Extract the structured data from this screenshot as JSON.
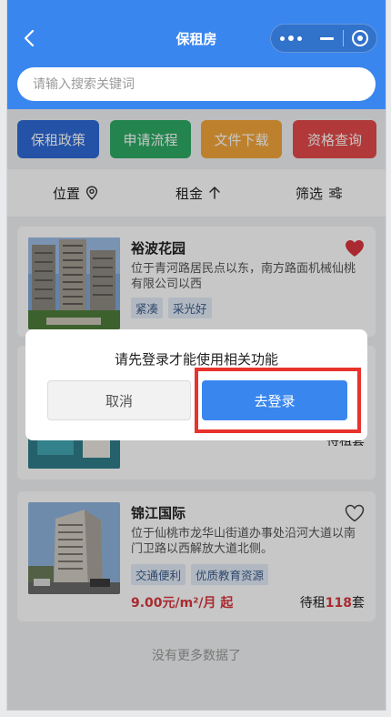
{
  "header": {
    "title": "保租房",
    "back_icon": "chevron-left-icon",
    "more_icon": "more-dots-icon",
    "minimize_icon": "minimize-icon",
    "close_icon": "target-close-icon"
  },
  "search": {
    "placeholder": "请输入搜索关键词",
    "value": ""
  },
  "quick_links": [
    {
      "label": "保租政策",
      "color": "#2e6ad6"
    },
    {
      "label": "申请流程",
      "color": "#2da964"
    },
    {
      "label": "文件下载",
      "color": "#f3a63a"
    },
    {
      "label": "资格查询",
      "color": "#e34a4a"
    }
  ],
  "filters": [
    {
      "label": "位置",
      "icon": "location-pin-icon"
    },
    {
      "label": "租金",
      "icon": "arrow-up-icon"
    },
    {
      "label": "筛选",
      "icon": "sliders-icon"
    }
  ],
  "listings": [
    {
      "name": "裕波花园",
      "address": "位于青河路居民点以东，南方路面机械仙桃有限公司以西",
      "tags": [
        "紧凑",
        "采光好"
      ],
      "favorited": true,
      "price": "",
      "available_prefix": "",
      "available_count": "",
      "available_suffix": ""
    },
    {
      "name": "",
      "address": "",
      "tags": [],
      "favorited": false,
      "price": "",
      "available_prefix": "待租",
      "available_count": "",
      "available_suffix": "套"
    },
    {
      "name": "锦江国际",
      "address": "位于仙桃市龙华山街道办事处沿河大道以南门卫路以西解放大道北侧。",
      "tags": [
        "交通便利",
        "优质教育资源"
      ],
      "favorited": false,
      "price": "9.00元/m²/月 起",
      "available_prefix": "待租",
      "available_count": "118",
      "available_suffix": "套"
    }
  ],
  "list_footer": "没有更多数据了",
  "modal": {
    "message": "请先登录才能使用相关功能",
    "cancel_label": "取消",
    "confirm_label": "去登录"
  },
  "colors": {
    "primary": "#3a86ef",
    "price_red": "#d9363e",
    "highlight_red": "#e8322c"
  }
}
